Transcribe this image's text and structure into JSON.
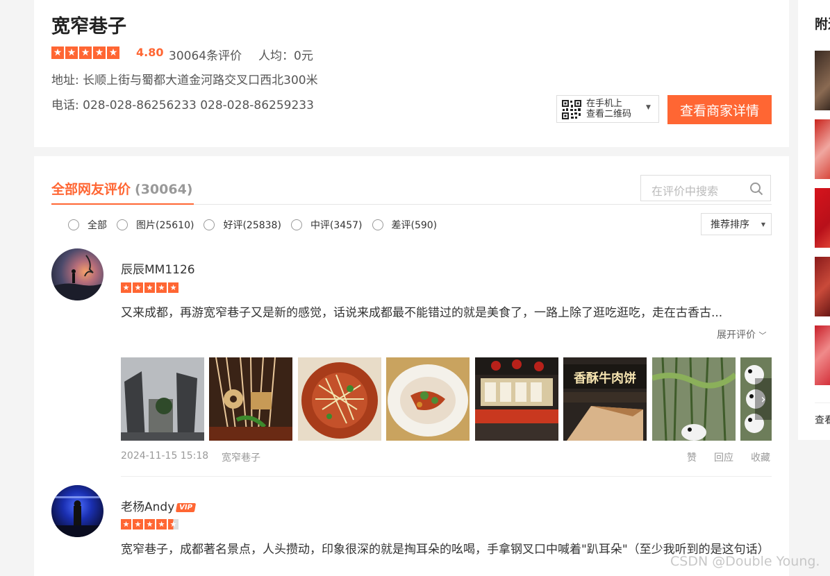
{
  "shop": {
    "name": "宽窄巷子",
    "score": "4.80",
    "review_count_text": "30064条评价",
    "avg_price_text": "人均：0元",
    "address": "地址: 长顺上街与蜀都大道金河路交叉口西北300米",
    "phone": "电话: 028-028-86256233 028-028-86259233",
    "qr_line1": "在手机上",
    "qr_line2": "查看二维码",
    "detail_button": "查看商家详情",
    "rating": 5
  },
  "reviews_panel": {
    "tab_label": "全部网友评价",
    "tab_count": "(30064)",
    "search_placeholder": "在评价中搜索",
    "filters": [
      {
        "label": "全部"
      },
      {
        "label": "图片(25610)"
      },
      {
        "label": "好评(25838)"
      },
      {
        "label": "中评(3457)"
      },
      {
        "label": "差评(590)"
      }
    ],
    "sort_label": "推荐排序"
  },
  "reviews": [
    {
      "user": "辰辰MM1126",
      "rating": 5,
      "text": "又来成都，再游宽窄巷子又是新的感觉，话说来成都最不能错过的就是美食了，一路上除了逛吃逛吃，走在古香古...",
      "expand_label": "展开评价",
      "date": "2024-11-15 15:18",
      "shop": "宽窄巷子",
      "actions": {
        "like": "赞",
        "reply": "回应",
        "favorite": "收藏"
      },
      "photo_count_visible": 8
    },
    {
      "user": "老杨Andy",
      "vip": "VIP",
      "rating": 4.5,
      "text": "宽窄巷子，成都著名景点，人头攒动，印象很深的就是掏耳朵的吆喝，手拿钢叉口中喊着\"趴耳朵\"（至少我听到的是这句话）"
    }
  ],
  "sidebar": {
    "title": "附近",
    "more": "查看更多"
  },
  "watermark": "CSDN @Double Young."
}
